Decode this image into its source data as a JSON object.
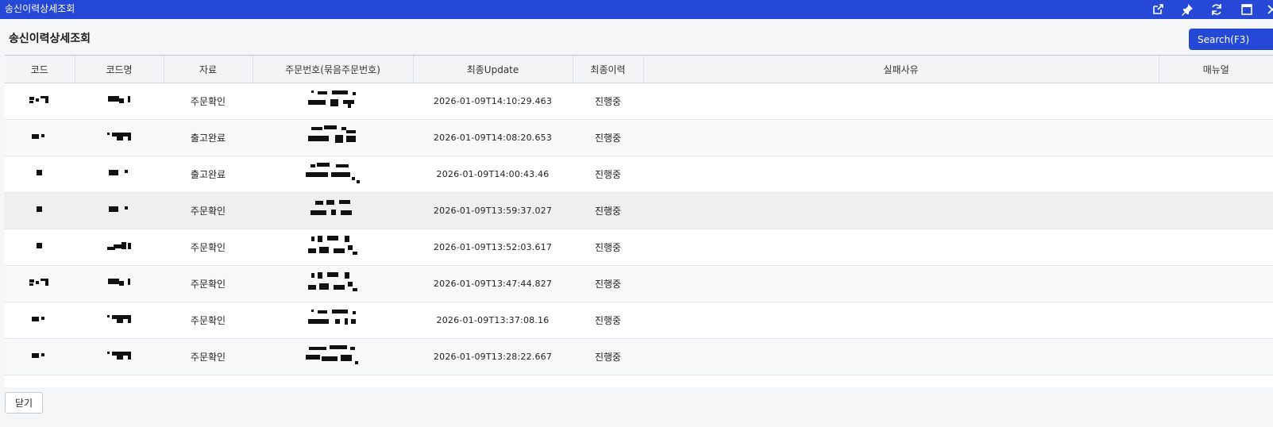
{
  "window": {
    "title": "송신이력상세조회",
    "icons": [
      "external-link-icon",
      "pin-icon",
      "refresh-icon",
      "maximize-icon",
      "close-icon"
    ]
  },
  "page": {
    "title": "송신이력상세조회",
    "search_label": "Search(F3)",
    "close_label": "닫기"
  },
  "table": {
    "columns": [
      "코드",
      "코드명",
      "자료",
      "주문번호(묶음주문번호)",
      "최종Update",
      "최종이력",
      "실패사유",
      "매뉴얼"
    ],
    "rows": [
      {
        "data": "주문확인",
        "updated": "2026-01-09T14:10:29.463",
        "status": "진행중"
      },
      {
        "data": "출고완료",
        "updated": "2026-01-09T14:08:20.653",
        "status": "진행중"
      },
      {
        "data": "출고완료",
        "updated": "2026-01-09T14:00:43.46",
        "status": "진행중"
      },
      {
        "data": "주문확인",
        "updated": "2026-01-09T13:59:37.027",
        "status": "진행중"
      },
      {
        "data": "주문확인",
        "updated": "2026-01-09T13:52:03.617",
        "status": "진행중"
      },
      {
        "data": "주문확인",
        "updated": "2026-01-09T13:47:44.827",
        "status": "진행중"
      },
      {
        "data": "주문확인",
        "updated": "2026-01-09T13:37:08.16",
        "status": "진행중"
      },
      {
        "data": "주문확인",
        "updated": "2026-01-09T13:28:22.667",
        "status": "진행중"
      }
    ]
  },
  "colors": {
    "titlebar": "#2549d6",
    "accent_button": "#2549d6",
    "header_bg": "#f3f4f6"
  }
}
